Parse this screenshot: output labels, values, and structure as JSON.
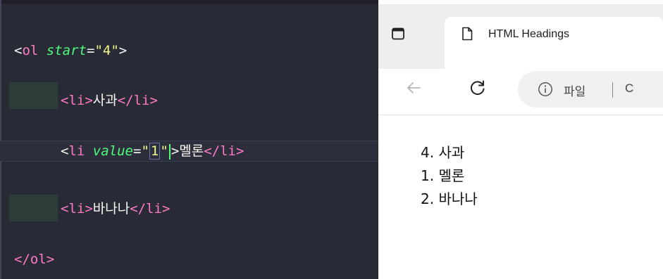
{
  "editor": {
    "lines": {
      "ol_open": {
        "lt": "<",
        "tag": "ol",
        "space": " ",
        "attr": "start",
        "eq": "=",
        "value": "\"4\"",
        "gt": ">"
      },
      "li1": {
        "open": "<li>",
        "text": "사과",
        "close": "</li>"
      },
      "li2": {
        "lt": "<",
        "tag": "li",
        "space": " ",
        "attr": "value",
        "eq": "=",
        "q1": "\"",
        "val": "1",
        "q2": "\"",
        "gt": ">",
        "text": "멜론",
        "close": "</li>"
      },
      "li3": {
        "open": "<li>",
        "text": "바나나",
        "close": "</li>"
      },
      "ol_close": {
        "text": "</ol>"
      }
    }
  },
  "browser": {
    "tab": {
      "title": "HTML Headings",
      "page_icon": "page-icon",
      "tab_actions_icon": "tab-actions-icon"
    },
    "nav": {
      "back_icon": "back-arrow-icon",
      "reload_icon": "reload-icon",
      "address": {
        "info_icon": "info-icon",
        "label": "파일",
        "rest": "C"
      }
    },
    "page": {
      "items": [
        {
          "number": "4.",
          "text": "사과"
        },
        {
          "number": "1.",
          "text": "멜론"
        },
        {
          "number": "2.",
          "text": "바나나"
        }
      ]
    }
  },
  "colors": {
    "editor_bg": "#282a36",
    "tag": "#ff79c6",
    "attribute": "#50fa7b",
    "string": "#f1fa8c",
    "text": "#f8f8f2",
    "browser_tab_strip": "#eeeeee"
  }
}
